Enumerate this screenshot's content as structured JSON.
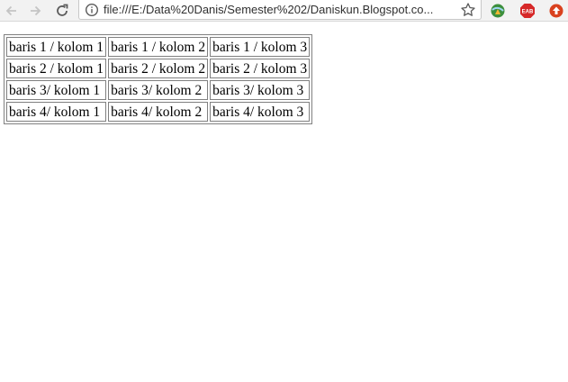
{
  "browser": {
    "url": "file:///E:/Data%20Danis/Semester%202/Daniskun.Blogspot.co...",
    "extensions": [
      {
        "name": "idm-icon"
      },
      {
        "name": "eab-icon",
        "label": "EAB"
      },
      {
        "name": "upload-icon"
      }
    ]
  },
  "table": {
    "rows": [
      [
        "baris 1 / kolom 1",
        "baris 1 / kolom 2",
        "baris 1 / kolom 3"
      ],
      [
        "baris 2 / kolom 1",
        "baris 2 / kolom 2",
        "baris 2 / kolom 3"
      ],
      [
        "baris 3/ kolom 1",
        "baris 3/ kolom 2",
        "baris 3/ kolom 3"
      ],
      [
        "baris 4/ kolom 1",
        "baris 4/ kolom 2",
        "baris 4/ kolom 3"
      ]
    ]
  }
}
